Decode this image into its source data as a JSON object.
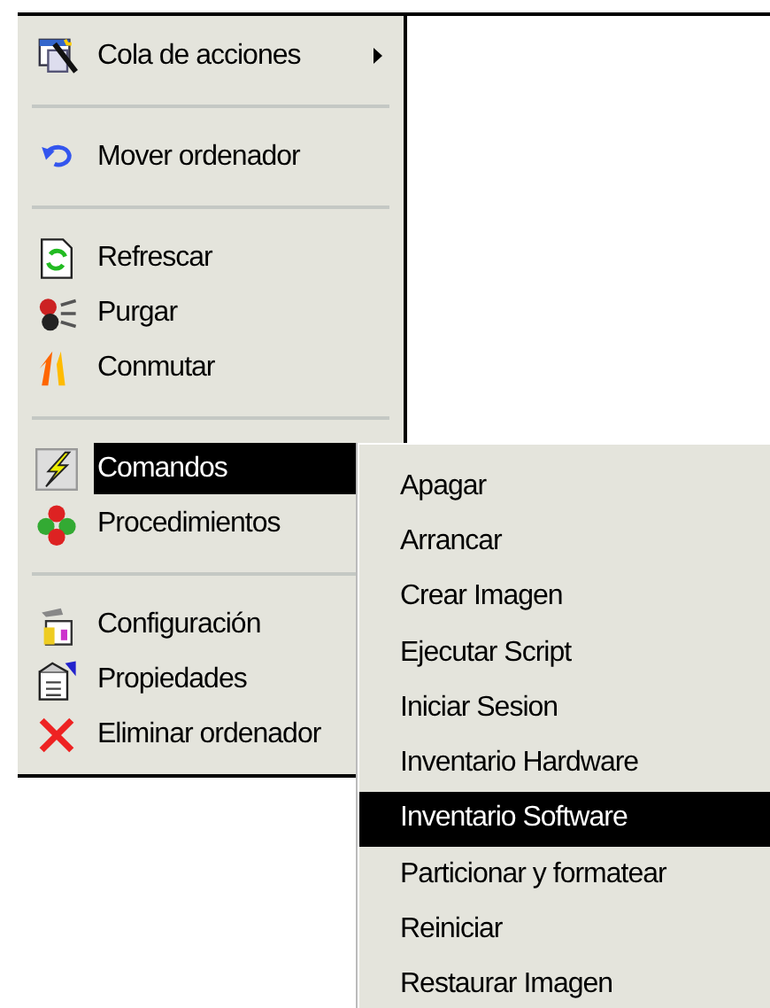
{
  "context_menu": {
    "items": [
      {
        "kind": "item",
        "label": "Cola de acciones",
        "has_submenu": true,
        "selected": false
      },
      {
        "kind": "separator"
      },
      {
        "kind": "item",
        "label": "Mover ordenador",
        "has_submenu": false,
        "selected": false
      },
      {
        "kind": "separator"
      },
      {
        "kind": "item",
        "label": "Refrescar",
        "has_submenu": false,
        "selected": false
      },
      {
        "kind": "item",
        "label": "Purgar",
        "has_submenu": false,
        "selected": false
      },
      {
        "kind": "item",
        "label": "Conmutar",
        "has_submenu": false,
        "selected": false
      },
      {
        "kind": "separator"
      },
      {
        "kind": "item",
        "label": "Comandos",
        "has_submenu": false,
        "selected": true
      },
      {
        "kind": "item",
        "label": "Procedimientos",
        "has_submenu": false,
        "selected": false
      },
      {
        "kind": "separator"
      },
      {
        "kind": "item",
        "label": "Configuración",
        "has_submenu": false,
        "selected": false
      },
      {
        "kind": "item",
        "label": "Propiedades",
        "has_submenu": false,
        "selected": false
      },
      {
        "kind": "item",
        "label": "Eliminar ordenador",
        "has_submenu": false,
        "selected": false
      }
    ]
  },
  "submenu": {
    "items": [
      {
        "label": "Apagar",
        "selected": false
      },
      {
        "label": "Arrancar",
        "selected": false
      },
      {
        "label": "Crear Imagen",
        "selected": false
      },
      {
        "label": "Ejecutar Script",
        "selected": false
      },
      {
        "label": "Iniciar Sesion",
        "selected": false
      },
      {
        "label": "Inventario Hardware",
        "selected": false
      },
      {
        "label": "Inventario Software",
        "selected": true
      },
      {
        "label": "Particionar y formatear",
        "selected": false
      },
      {
        "label": "Reiniciar",
        "selected": false
      },
      {
        "label": "Restaurar Imagen",
        "selected": false
      }
    ]
  }
}
